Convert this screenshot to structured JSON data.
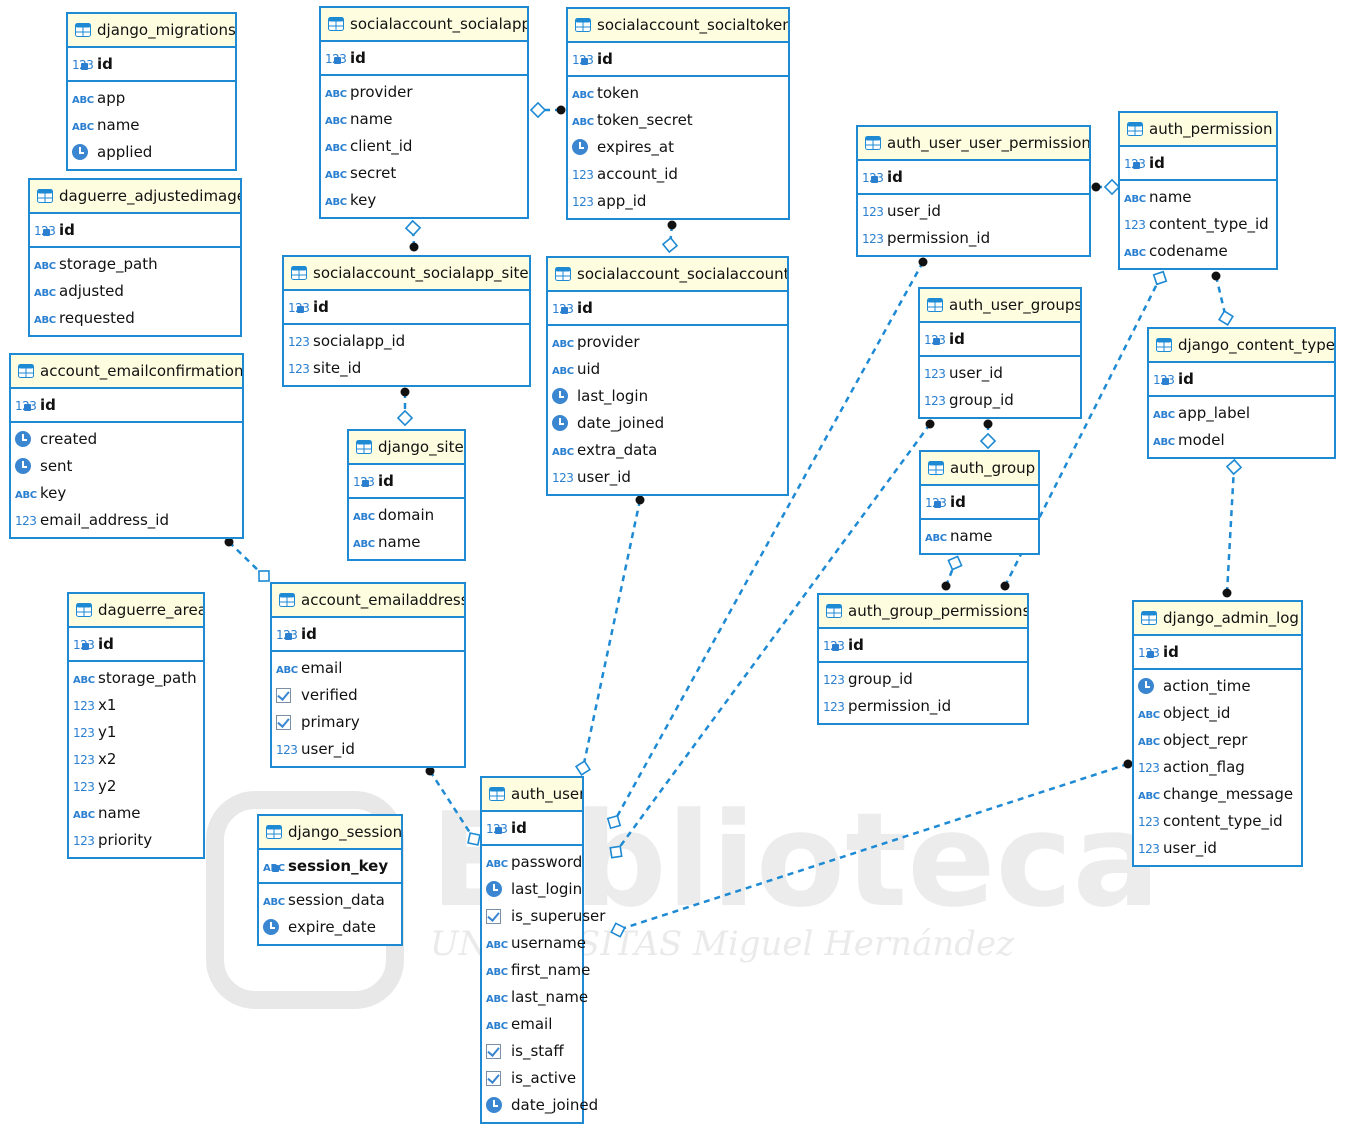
{
  "watermark": {
    "text": "Biblioteca",
    "subtitle": "UNIVERSITAS Miguel Hernández"
  },
  "colors": {
    "border": "#1e8ad4",
    "header_bg": "#fffde0",
    "icon": "#2a7fd0",
    "edge": "#1e8ad4"
  },
  "type_icons": {
    "number": "123",
    "string": "ABC",
    "datetime": "clock-icon",
    "boolean": "checkbox-icon"
  },
  "tables": [
    {
      "id": "django_migrations",
      "name": "django_migrations",
      "pk": {
        "name": "id",
        "type": "number"
      },
      "columns": [
        {
          "name": "app",
          "type": "string"
        },
        {
          "name": "name",
          "type": "string"
        },
        {
          "name": "applied",
          "type": "datetime"
        }
      ]
    },
    {
      "id": "daguerre_adjustedimage",
      "name": "daguerre_adjustedimage",
      "pk": {
        "name": "id",
        "type": "number"
      },
      "columns": [
        {
          "name": "storage_path",
          "type": "string"
        },
        {
          "name": "adjusted",
          "type": "string"
        },
        {
          "name": "requested",
          "type": "string"
        }
      ]
    },
    {
      "id": "account_emailconfirmation",
      "name": "account_emailconfirmation",
      "pk": {
        "name": "id",
        "type": "number"
      },
      "columns": [
        {
          "name": "created",
          "type": "datetime"
        },
        {
          "name": "sent",
          "type": "datetime"
        },
        {
          "name": "key",
          "type": "string"
        },
        {
          "name": "email_address_id",
          "type": "number"
        }
      ]
    },
    {
      "id": "daguerre_area",
      "name": "daguerre_area",
      "pk": {
        "name": "id",
        "type": "number"
      },
      "columns": [
        {
          "name": "storage_path",
          "type": "string"
        },
        {
          "name": "x1",
          "type": "number"
        },
        {
          "name": "y1",
          "type": "number"
        },
        {
          "name": "x2",
          "type": "number"
        },
        {
          "name": "y2",
          "type": "number"
        },
        {
          "name": "name",
          "type": "string"
        },
        {
          "name": "priority",
          "type": "number"
        }
      ]
    },
    {
      "id": "socialaccount_socialapp",
      "name": "socialaccount_socialapp",
      "pk": {
        "name": "id",
        "type": "number"
      },
      "columns": [
        {
          "name": "provider",
          "type": "string"
        },
        {
          "name": "name",
          "type": "string"
        },
        {
          "name": "client_id",
          "type": "string"
        },
        {
          "name": "secret",
          "type": "string"
        },
        {
          "name": "key",
          "type": "string"
        }
      ]
    },
    {
      "id": "socialaccount_socialapp_sites",
      "name": "socialaccount_socialapp_sites",
      "pk": {
        "name": "id",
        "type": "number"
      },
      "columns": [
        {
          "name": "socialapp_id",
          "type": "number"
        },
        {
          "name": "site_id",
          "type": "number"
        }
      ]
    },
    {
      "id": "django_site",
      "name": "django_site",
      "pk": {
        "name": "id",
        "type": "number"
      },
      "columns": [
        {
          "name": "domain",
          "type": "string"
        },
        {
          "name": "name",
          "type": "string"
        }
      ]
    },
    {
      "id": "account_emailaddress",
      "name": "account_emailaddress",
      "pk": {
        "name": "id",
        "type": "number"
      },
      "columns": [
        {
          "name": "email",
          "type": "string"
        },
        {
          "name": "verified",
          "type": "boolean"
        },
        {
          "name": "primary",
          "type": "boolean"
        },
        {
          "name": "user_id",
          "type": "number"
        }
      ]
    },
    {
      "id": "django_session",
      "name": "django_session",
      "pk": {
        "name": "session_key",
        "type": "string"
      },
      "columns": [
        {
          "name": "session_data",
          "type": "string"
        },
        {
          "name": "expire_date",
          "type": "datetime"
        }
      ]
    },
    {
      "id": "socialaccount_socialtoken",
      "name": "socialaccount_socialtoken",
      "pk": {
        "name": "id",
        "type": "number"
      },
      "columns": [
        {
          "name": "token",
          "type": "string"
        },
        {
          "name": "token_secret",
          "type": "string"
        },
        {
          "name": "expires_at",
          "type": "datetime"
        },
        {
          "name": "account_id",
          "type": "number"
        },
        {
          "name": "app_id",
          "type": "number"
        }
      ]
    },
    {
      "id": "socialaccount_socialaccount",
      "name": "socialaccount_socialaccount",
      "pk": {
        "name": "id",
        "type": "number"
      },
      "columns": [
        {
          "name": "provider",
          "type": "string"
        },
        {
          "name": "uid",
          "type": "string"
        },
        {
          "name": "last_login",
          "type": "datetime"
        },
        {
          "name": "date_joined",
          "type": "datetime"
        },
        {
          "name": "extra_data",
          "type": "string"
        },
        {
          "name": "user_id",
          "type": "number"
        }
      ]
    },
    {
      "id": "auth_user",
      "name": "auth_user",
      "pk": {
        "name": "id",
        "type": "number"
      },
      "columns": [
        {
          "name": "password",
          "type": "string"
        },
        {
          "name": "last_login",
          "type": "datetime"
        },
        {
          "name": "is_superuser",
          "type": "boolean"
        },
        {
          "name": "username",
          "type": "string"
        },
        {
          "name": "first_name",
          "type": "string"
        },
        {
          "name": "last_name",
          "type": "string"
        },
        {
          "name": "email",
          "type": "string"
        },
        {
          "name": "is_staff",
          "type": "boolean"
        },
        {
          "name": "is_active",
          "type": "boolean"
        },
        {
          "name": "date_joined",
          "type": "datetime"
        }
      ]
    },
    {
      "id": "auth_user_user_permissions",
      "name": "auth_user_user_permissions",
      "pk": {
        "name": "id",
        "type": "number"
      },
      "columns": [
        {
          "name": "user_id",
          "type": "number"
        },
        {
          "name": "permission_id",
          "type": "number"
        }
      ]
    },
    {
      "id": "auth_user_groups",
      "name": "auth_user_groups",
      "pk": {
        "name": "id",
        "type": "number"
      },
      "columns": [
        {
          "name": "user_id",
          "type": "number"
        },
        {
          "name": "group_id",
          "type": "number"
        }
      ]
    },
    {
      "id": "auth_group",
      "name": "auth_group",
      "pk": {
        "name": "id",
        "type": "number"
      },
      "columns": [
        {
          "name": "name",
          "type": "string"
        }
      ]
    },
    {
      "id": "auth_group_permissions",
      "name": "auth_group_permissions",
      "pk": {
        "name": "id",
        "type": "number"
      },
      "columns": [
        {
          "name": "group_id",
          "type": "number"
        },
        {
          "name": "permission_id",
          "type": "number"
        }
      ]
    },
    {
      "id": "auth_permission",
      "name": "auth_permission",
      "pk": {
        "name": "id",
        "type": "number"
      },
      "columns": [
        {
          "name": "name",
          "type": "string"
        },
        {
          "name": "content_type_id",
          "type": "number"
        },
        {
          "name": "codename",
          "type": "string"
        }
      ]
    },
    {
      "id": "django_content_type",
      "name": "django_content_type",
      "pk": {
        "name": "id",
        "type": "number"
      },
      "columns": [
        {
          "name": "app_label",
          "type": "string"
        },
        {
          "name": "model",
          "type": "string"
        }
      ]
    },
    {
      "id": "django_admin_log",
      "name": "django_admin_log",
      "pk": {
        "name": "id",
        "type": "number"
      },
      "columns": [
        {
          "name": "action_time",
          "type": "datetime"
        },
        {
          "name": "object_id",
          "type": "string"
        },
        {
          "name": "object_repr",
          "type": "string"
        },
        {
          "name": "action_flag",
          "type": "number"
        },
        {
          "name": "change_message",
          "type": "string"
        },
        {
          "name": "content_type_id",
          "type": "number"
        },
        {
          "name": "user_id",
          "type": "number"
        }
      ]
    }
  ],
  "relationships": [
    {
      "from": "account_emailconfirmation",
      "to": "account_emailaddress"
    },
    {
      "from": "account_emailaddress",
      "to": "auth_user"
    },
    {
      "from": "socialaccount_socialapp_sites",
      "to": "socialaccount_socialapp"
    },
    {
      "from": "socialaccount_socialapp_sites",
      "to": "django_site"
    },
    {
      "from": "socialaccount_socialtoken",
      "to": "socialaccount_socialapp"
    },
    {
      "from": "socialaccount_socialtoken",
      "to": "socialaccount_socialaccount"
    },
    {
      "from": "socialaccount_socialaccount",
      "to": "auth_user"
    },
    {
      "from": "auth_user_user_permissions",
      "to": "auth_user"
    },
    {
      "from": "auth_user_user_permissions",
      "to": "auth_permission"
    },
    {
      "from": "auth_user_groups",
      "to": "auth_user"
    },
    {
      "from": "auth_user_groups",
      "to": "auth_group"
    },
    {
      "from": "auth_group_permissions",
      "to": "auth_group"
    },
    {
      "from": "auth_group_permissions",
      "to": "auth_permission"
    },
    {
      "from": "auth_permission",
      "to": "django_content_type"
    },
    {
      "from": "django_admin_log",
      "to": "django_content_type"
    },
    {
      "from": "django_admin_log",
      "to": "auth_user"
    }
  ]
}
